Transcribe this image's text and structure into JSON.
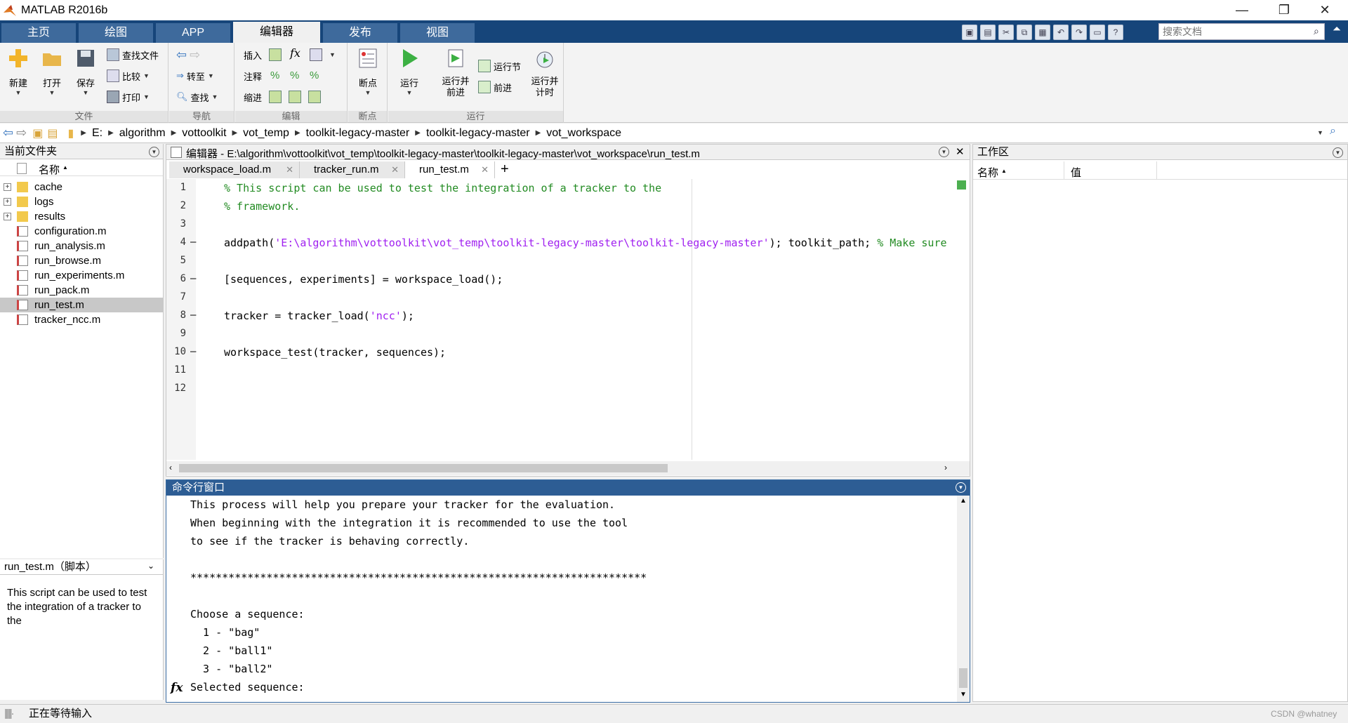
{
  "app": {
    "title": "MATLAB R2016b"
  },
  "ribbon_tabs": [
    "主页",
    "绘图",
    "APP",
    "编辑器",
    "发布",
    "视图"
  ],
  "active_tab": "编辑器",
  "search_placeholder": "搜索文档",
  "ribbon": {
    "file": {
      "label": "文件",
      "new": "新建",
      "open": "打开",
      "save": "保存",
      "find_files": "查找文件",
      "compare": "比较",
      "print": "打印"
    },
    "nav": {
      "label": "导航",
      "goto": "转至",
      "find": "查找"
    },
    "edit": {
      "label": "编辑",
      "insert": "插入",
      "comment": "注释",
      "indent": "缩进",
      "fx": "fx"
    },
    "breakpoints": {
      "label": "断点",
      "bp": "断点"
    },
    "run": {
      "label": "运行",
      "run": "运行",
      "run_advance": "运行并\n前进",
      "run_section": "运行节",
      "advance": "前进",
      "run_time": "运行并\n计时"
    }
  },
  "address": {
    "drive": "E:",
    "crumbs": [
      "algorithm",
      "vottoolkit",
      "vot_temp",
      "toolkit-legacy-master",
      "toolkit-legacy-master",
      "vot_workspace"
    ]
  },
  "current_folder": {
    "title": "当前文件夹",
    "col_name": "名称",
    "items": [
      {
        "name": "cache",
        "type": "folder"
      },
      {
        "name": "logs",
        "type": "folder"
      },
      {
        "name": "results",
        "type": "folder"
      },
      {
        "name": "configuration.m",
        "type": "file"
      },
      {
        "name": "run_analysis.m",
        "type": "file"
      },
      {
        "name": "run_browse.m",
        "type": "file"
      },
      {
        "name": "run_experiments.m",
        "type": "file"
      },
      {
        "name": "run_pack.m",
        "type": "file"
      },
      {
        "name": "run_test.m",
        "type": "file",
        "selected": true
      },
      {
        "name": "tracker_ncc.m",
        "type": "file"
      }
    ]
  },
  "details": {
    "title": "run_test.m（脚本）",
    "description": "This script can be used to test the integration of a tracker to the"
  },
  "editor": {
    "title": "编辑器 - E:\\algorithm\\vottoolkit\\vot_temp\\toolkit-legacy-master\\toolkit-legacy-master\\vot_workspace\\run_test.m",
    "tabs": [
      "workspace_load.m",
      "tracker_run.m",
      "run_test.m"
    ],
    "active_tab": "run_test.m",
    "lines": [
      {
        "n": "1",
        "dash": "",
        "parts": [
          {
            "t": "% This script can be used to test the integration of a tracker to the",
            "c": "cm"
          }
        ]
      },
      {
        "n": "2",
        "dash": "",
        "parts": [
          {
            "t": "% framework.",
            "c": "cm"
          }
        ]
      },
      {
        "n": "3",
        "dash": "",
        "parts": []
      },
      {
        "n": "4",
        "dash": "—",
        "parts": [
          {
            "t": "addpath(",
            "c": ""
          },
          {
            "t": "'E:\\algorithm\\vottoolkit\\vot_temp\\toolkit-legacy-master\\toolkit-legacy-master'",
            "c": "str"
          },
          {
            "t": "); toolkit_path; ",
            "c": ""
          },
          {
            "t": "% Make sure t",
            "c": "cm"
          }
        ]
      },
      {
        "n": "5",
        "dash": "",
        "parts": []
      },
      {
        "n": "6",
        "dash": "—",
        "parts": [
          {
            "t": "[sequences, experiments] = workspace_load();",
            "c": ""
          }
        ]
      },
      {
        "n": "7",
        "dash": "",
        "parts": []
      },
      {
        "n": "8",
        "dash": "—",
        "parts": [
          {
            "t": "tracker = tracker_load(",
            "c": ""
          },
          {
            "t": "'ncc'",
            "c": "str"
          },
          {
            "t": ");",
            "c": ""
          }
        ]
      },
      {
        "n": "9",
        "dash": "",
        "parts": []
      },
      {
        "n": "10",
        "dash": "—",
        "parts": [
          {
            "t": "workspace_test(tracker, sequences);",
            "c": ""
          }
        ]
      },
      {
        "n": "11",
        "dash": "",
        "parts": []
      },
      {
        "n": "12",
        "dash": "",
        "parts": []
      }
    ]
  },
  "command_window": {
    "title": "命令行窗口",
    "lines": [
      "This process will help you prepare your tracker for the evaluation.",
      "When beginning with the integration it is recommended to use the tool",
      "to see if the tracker is behaving correctly.",
      "",
      "************************************************************************",
      "",
      "Choose a sequence:",
      "  1 - \"bag\"",
      "  2 - \"ball1\"",
      "  3 - \"ball2\"",
      "Selected sequence: "
    ],
    "prompt": "fx"
  },
  "workspace": {
    "title": "工作区",
    "col_name": "名称",
    "col_value": "值"
  },
  "status": {
    "text": "正在等待输入",
    "watermark": "CSDN @whatney"
  },
  "colors": {
    "tabstrip": "#16457a",
    "cmd_title": "#2d5d94",
    "comment": "#228b22",
    "string": "#a020f0"
  }
}
